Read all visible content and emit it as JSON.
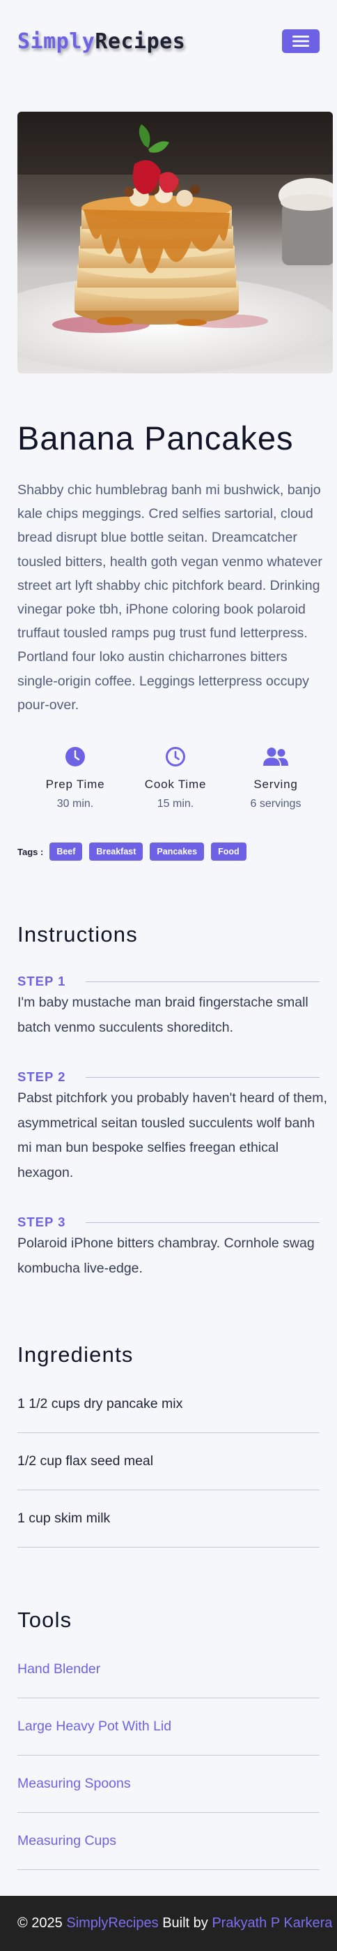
{
  "header": {
    "brand_accent": "Simply",
    "brand_rest": "Recipes",
    "menu_icon": "hamburger-menu-icon"
  },
  "recipe": {
    "title": "Banana Pancakes",
    "description": "Shabby chic humblebrag banh mi bushwick, banjo kale chips meggings. Cred selfies sartorial, cloud bread disrupt blue bottle seitan. Dreamcatcher tousled bitters, health goth vegan venmo whatever street art lyft shabby chic pitchfork beard. Drinking vinegar poke tbh, iPhone coloring book polaroid truffaut tousled ramps pug trust fund letterpress. Portland four loko austin chicharrones bitters single-origin coffee. Leggings letterpress occupy pour-over.",
    "stats": [
      {
        "icon": "clock-filled-icon",
        "label": "Prep Time",
        "value": "30 min."
      },
      {
        "icon": "clock-outline-icon",
        "label": "Cook Time",
        "value": "15 min."
      },
      {
        "icon": "users-icon",
        "label": "Serving",
        "value": "6 servings"
      }
    ],
    "tags_label": "Tags :",
    "tags": [
      "Beef",
      "Breakfast",
      "Pancakes",
      "Food"
    ]
  },
  "instructions": {
    "heading": "Instructions",
    "steps": [
      {
        "label": "STEP 1",
        "text": "I'm baby mustache man braid fingerstache small batch venmo succulents shoreditch."
      },
      {
        "label": "STEP 2",
        "text": "Pabst pitchfork you probably haven't heard of them, asymmetrical seitan tousled succulents wolf banh mi man bun bespoke selfies freegan ethical hexagon."
      },
      {
        "label": "STEP 3",
        "text": "Polaroid iPhone bitters chambray. Cornhole swag kombucha live-edge."
      }
    ]
  },
  "ingredients": {
    "heading": "Ingredients",
    "items": [
      "1 1/2 cups dry pancake mix",
      "1/2 cup flax seed meal",
      "1 cup skim milk"
    ]
  },
  "tools": {
    "heading": "Tools",
    "items": [
      "Hand Blender",
      "Large Heavy Pot With Lid",
      "Measuring Spoons",
      "Measuring Cups"
    ]
  },
  "footer": {
    "copyright": "© 2025",
    "site": "SimplyRecipes",
    "built_by": "Built by",
    "author": "Prakyath P Karkera"
  },
  "colors": {
    "accent": "#6d62e6",
    "background": "#f5f7fb",
    "footer_bg": "#222222"
  }
}
